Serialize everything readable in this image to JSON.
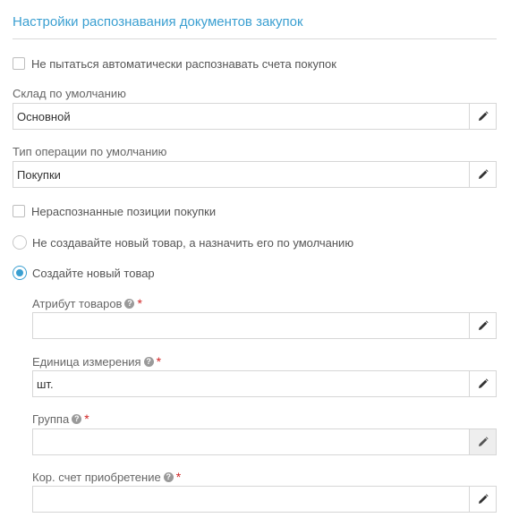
{
  "section": {
    "title": "Настройки распознавания документов закупок"
  },
  "auto_recognize": {
    "label": "Не пытаться автоматически распознавать счета покупок",
    "checked": false
  },
  "warehouse": {
    "label": "Склад по умолчанию",
    "value": "Основной",
    "edit_icon": "pencil-icon"
  },
  "operation_type": {
    "label": "Тип операции по умолчанию",
    "value": "Покупки",
    "edit_icon": "pencil-icon"
  },
  "unrecognized": {
    "label": "Нераспознанные позиции покупки",
    "checked": false
  },
  "radio_options": [
    {
      "label": "Не создавайте новый товар, а назначить его по умолчанию",
      "selected": false
    },
    {
      "label": "Создайте новый товар",
      "selected": true
    }
  ],
  "new_item_fields": {
    "attribute": {
      "label": "Атрибут товаров",
      "value": "",
      "required": "*",
      "help_icon": "question-circle-icon"
    },
    "unit": {
      "label": "Единица измерения",
      "value": "шт.",
      "required": "*",
      "help_icon": "question-circle-icon"
    },
    "group": {
      "label": "Группа",
      "value": "",
      "required": "*",
      "help_icon": "question-circle-icon",
      "edit_disabled": true
    },
    "account": {
      "label": "Кор. счет приобретение",
      "value": "",
      "required": "*",
      "help_icon": "question-circle-icon"
    }
  },
  "colors": {
    "accent": "#3a9fd1",
    "required": "#d02424",
    "border": "#d6d6d6"
  }
}
